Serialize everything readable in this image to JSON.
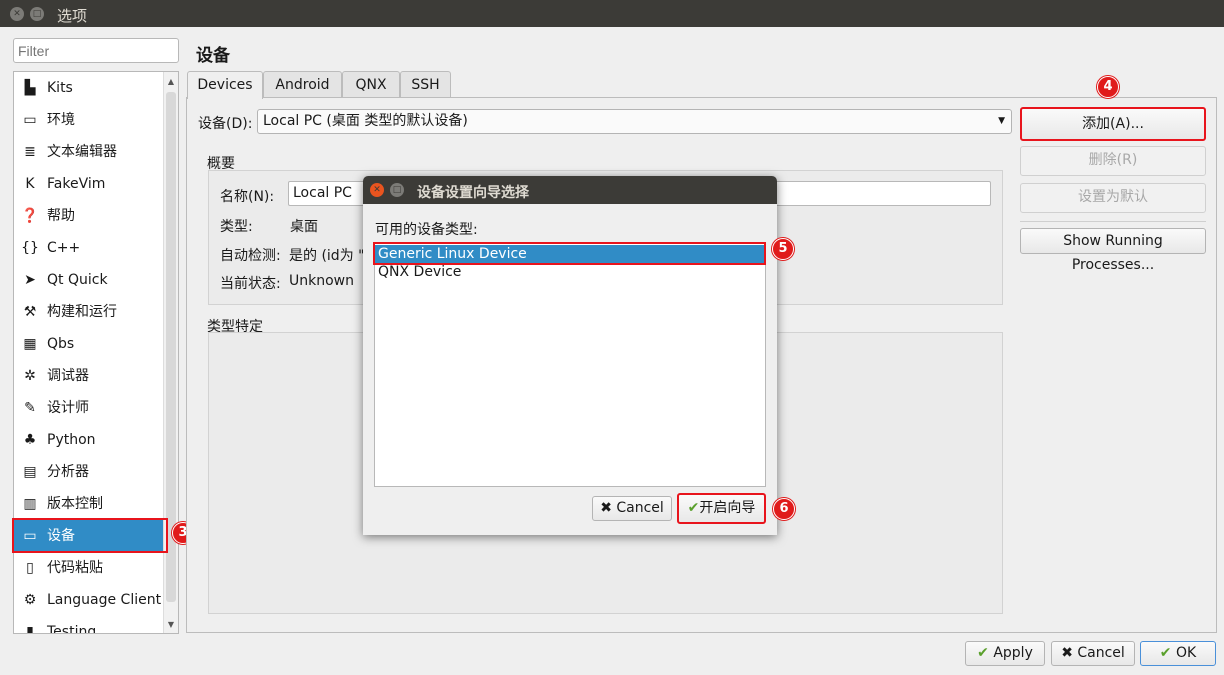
{
  "window": {
    "title": "选项"
  },
  "sidebar": {
    "filter_placeholder": "Filter",
    "items": [
      {
        "label": "Kits",
        "icon": "kits-icon",
        "glyph": "▙"
      },
      {
        "label": "环境",
        "icon": "monitor-icon",
        "glyph": "▭"
      },
      {
        "label": "文本编辑器",
        "icon": "text-editor-icon",
        "glyph": "≣"
      },
      {
        "label": "FakeVim",
        "icon": "fakevim-icon",
        "glyph": "K"
      },
      {
        "label": "帮助",
        "icon": "help-icon",
        "glyph": "❓"
      },
      {
        "label": "C++",
        "icon": "cpp-icon",
        "glyph": "{}"
      },
      {
        "label": "Qt Quick",
        "icon": "qtquick-icon",
        "glyph": "➤"
      },
      {
        "label": "构建和运行",
        "icon": "hammer-icon",
        "glyph": "⚒"
      },
      {
        "label": "Qbs",
        "icon": "qbs-icon",
        "glyph": "▦"
      },
      {
        "label": "调试器",
        "icon": "bug-icon",
        "glyph": "✲"
      },
      {
        "label": "设计师",
        "icon": "pen-icon",
        "glyph": "✎"
      },
      {
        "label": "Python",
        "icon": "python-icon",
        "glyph": "♣"
      },
      {
        "label": "分析器",
        "icon": "analyzer-icon",
        "glyph": "▤"
      },
      {
        "label": "版本控制",
        "icon": "version-control-icon",
        "glyph": "▥"
      },
      {
        "label": "设备",
        "icon": "device-icon",
        "glyph": "▭"
      },
      {
        "label": "代码粘贴",
        "icon": "paste-icon",
        "glyph": "▯"
      },
      {
        "label": "Language Client",
        "icon": "language-client-icon",
        "glyph": "⚙"
      },
      {
        "label": "Testing",
        "icon": "testing-icon",
        "glyph": "▮"
      }
    ],
    "selected": "设备"
  },
  "page": {
    "title": "设备",
    "tabs": [
      "Devices",
      "Android",
      "QNX",
      "SSH"
    ],
    "active_tab": "Devices",
    "device_label": "设备(D):",
    "device_value": "Local PC (桌面 类型的默认设备)",
    "buttons": {
      "add": "添加(A)...",
      "remove": "删除(R)",
      "set_default": "设置为默认",
      "show_processes": "Show Running Processes..."
    },
    "overview": {
      "title": "概要",
      "name_label": "名称(N):",
      "name_value": "Local PC",
      "type_label": "类型:",
      "type_value": "桌面",
      "auto_label": "自动检测:",
      "auto_value": "是的 (id为 \"",
      "state_label": "当前状态:",
      "state_value": "Unknown"
    },
    "type_specific": {
      "title": "类型特定"
    }
  },
  "dialog": {
    "title": "设备设置向导选择",
    "label": "可用的设备类型:",
    "options": [
      "Generic Linux Device",
      "QNX Device"
    ],
    "selected": "Generic Linux Device",
    "cancel": "Cancel",
    "start": "开启向导"
  },
  "footer": {
    "apply": "Apply",
    "cancel": "Cancel",
    "ok": "OK"
  },
  "annotations": [
    "3",
    "4",
    "5",
    "6"
  ],
  "colors": {
    "selection": "#308cc6",
    "annotation": "#e01b1b",
    "titlebar": "#3c3b37"
  }
}
